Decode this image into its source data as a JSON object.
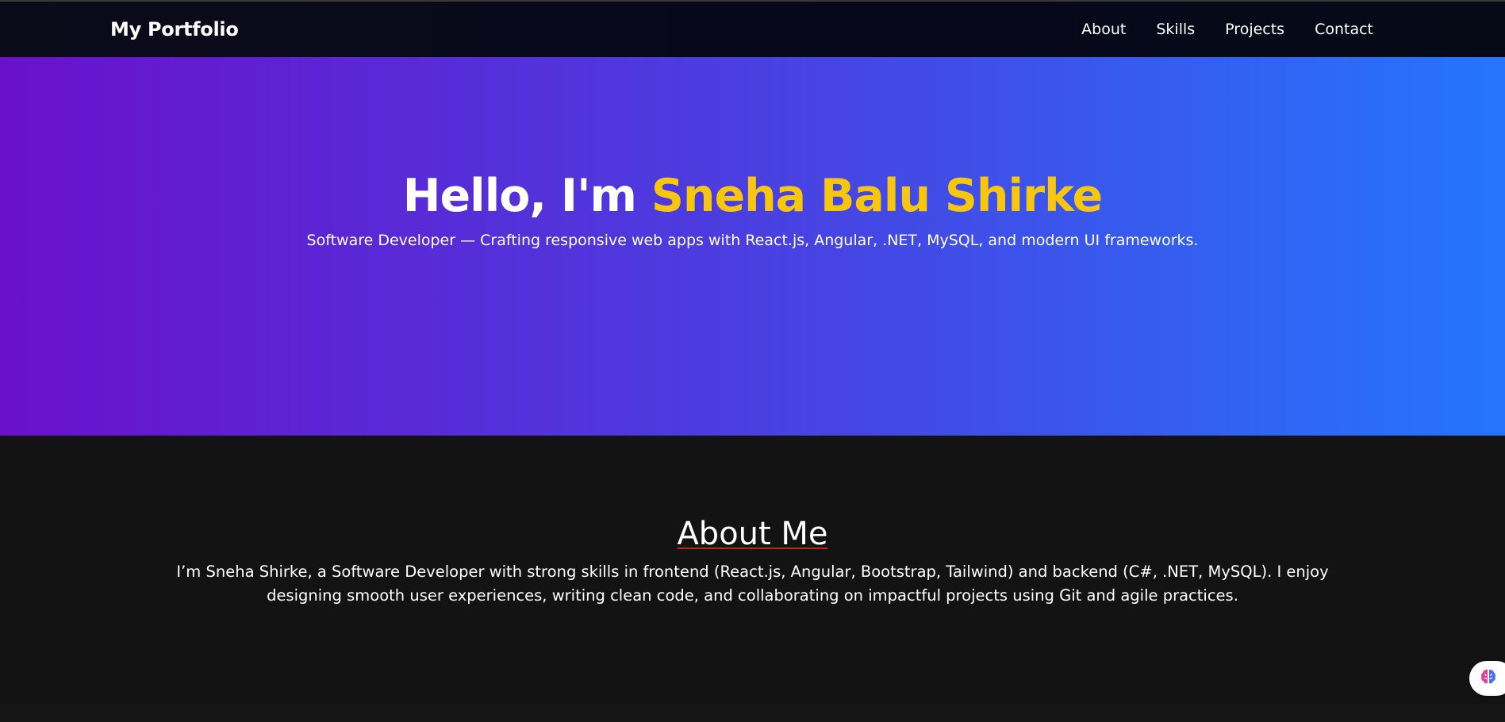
{
  "nav": {
    "brand": "My Portfolio",
    "links": [
      "About",
      "Skills",
      "Projects",
      "Contact"
    ]
  },
  "hero": {
    "greeting": "Hello, I'm",
    "name": "Sneha Balu Shirke",
    "subtitle": "Software Developer — Crafting responsive web apps with React.js, Angular, .NET, MySQL, and modern UI frameworks."
  },
  "about": {
    "title": "About Me",
    "text": "I’m Sneha Shirke, a Software Developer with strong skills in frontend (React.js, Angular, Bootstrap, Tailwind) and backend (C#, .NET, MySQL). I enjoy designing smooth user experiences, writing clean code, and collaborating on impactful projects using Git and agile practices."
  },
  "icons": {
    "assistant": "brain-icon"
  },
  "colors": {
    "hero_gradient_start": "#6a11cb",
    "hero_gradient_end": "#2575fc",
    "name_accent": "#f7c60f",
    "nav_background": "#06081a",
    "section_background": "#131313",
    "title_underline": "#b3261e"
  }
}
